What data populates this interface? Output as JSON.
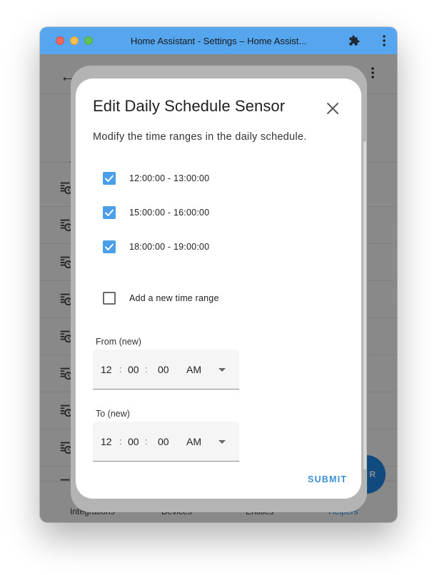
{
  "window": {
    "title": "Home Assistant - Settings – Home Assist..."
  },
  "app": {
    "bottom_nav": [
      {
        "label": "Integrations"
      },
      {
        "label": "Devices"
      },
      {
        "label": "Entities"
      },
      {
        "label": "Helpers"
      }
    ],
    "fab_label": "R"
  },
  "dialog": {
    "title": "Edit Daily Schedule Sensor",
    "description": "Modify the time ranges in the daily schedule.",
    "time_ranges": [
      {
        "label": "12:00:00 - 13:00:00",
        "checked": true
      },
      {
        "label": "15:00:00 - 16:00:00",
        "checked": true
      },
      {
        "label": "18:00:00 - 19:00:00",
        "checked": true
      }
    ],
    "add_new": {
      "label": "Add a new time range",
      "checked": false
    },
    "from_field": {
      "label": "From (new)",
      "hour": "12",
      "minute": "00",
      "second": "00",
      "period": "AM"
    },
    "to_field": {
      "label": "To (new)",
      "hour": "12",
      "minute": "00",
      "second": "00",
      "period": "AM"
    },
    "submit_label": "SUBMIT"
  },
  "colors": {
    "titlebar": "#55a6ee",
    "accent": "#4a9fe8",
    "submit": "#3b8fd6"
  }
}
